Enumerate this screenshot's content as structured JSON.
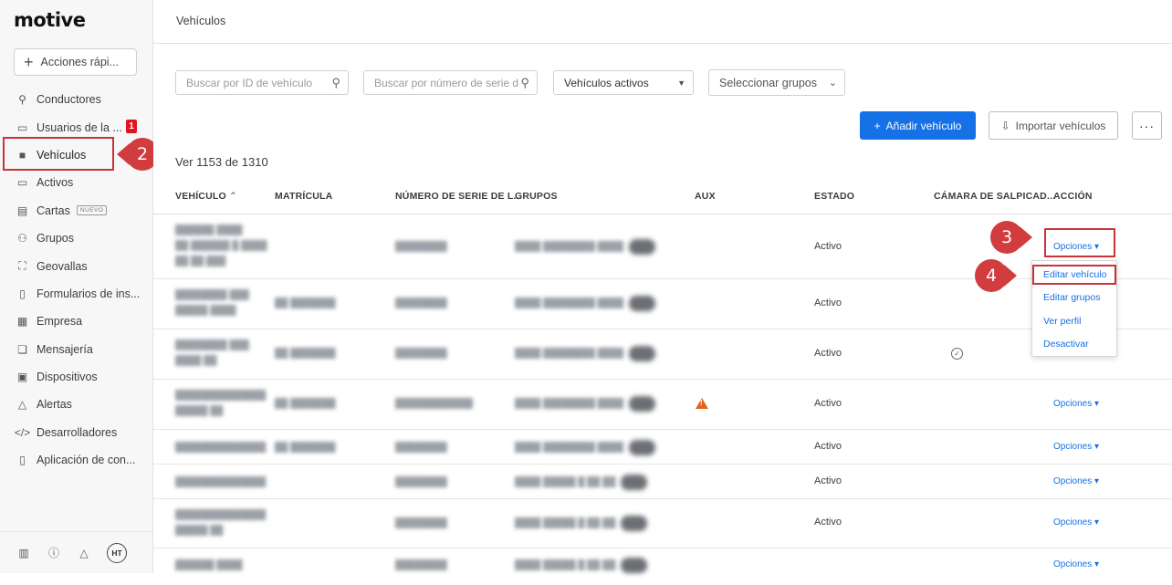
{
  "brand": {
    "name": "motive"
  },
  "sidebar": {
    "quick_actions": "Acciones rápi...",
    "items": [
      {
        "label": "Conductores",
        "icon": "person-icon"
      },
      {
        "label": "Usuarios de la ...",
        "icon": "monitor-icon",
        "badge": "1"
      },
      {
        "label": "Vehículos",
        "icon": "truck-icon"
      },
      {
        "label": "Activos",
        "icon": "trailer-icon"
      },
      {
        "label": "Cartas",
        "icon": "card-icon",
        "tag": "NUEVO"
      },
      {
        "label": "Grupos",
        "icon": "group-icon"
      },
      {
        "label": "Geovallas",
        "icon": "geofence-icon"
      },
      {
        "label": "Formularios de ins...",
        "icon": "document-icon"
      },
      {
        "label": "Empresa",
        "icon": "building-icon"
      },
      {
        "label": "Mensajería",
        "icon": "chat-icon"
      },
      {
        "label": "Dispositivos",
        "icon": "devices-icon"
      },
      {
        "label": "Alertas",
        "icon": "bell-icon"
      },
      {
        "label": "Desarrolladores",
        "icon": "code-icon"
      },
      {
        "label": "Aplicación de con...",
        "icon": "phone-icon"
      }
    ],
    "avatar": "HT"
  },
  "header": {
    "title": "Vehículos"
  },
  "filters": {
    "search_id_placeholder": "Buscar por ID de vehículo",
    "search_serial_placeholder": "Buscar por número de serie d",
    "status_select": "Vehículos activos",
    "groups_select": "Seleccionar grupos"
  },
  "actions": {
    "add": "Añadir vehículo",
    "import": "Importar vehículos",
    "more": "···"
  },
  "count_text": "Ver 1153 de 1310",
  "table": {
    "headers": [
      "VEHÍCULO",
      "MATRÍCULA",
      "NÚMERO DE SERIE DE L...",
      "GRUPOS",
      "AUX",
      "ESTADO",
      "CÁMARA DE SALPICAD...",
      "ACCIÓN"
    ],
    "rows": [
      {
        "status": "Activo",
        "action": "Opciones ▾"
      },
      {
        "status": "Activo",
        "action": ""
      },
      {
        "status": "Activo",
        "action": ""
      },
      {
        "status": "Activo",
        "action": "Opciones ▾"
      },
      {
        "status": "Activo",
        "action": "Opciones ▾"
      },
      {
        "status": "Activo",
        "action": "Opciones ▾"
      },
      {
        "status": "Activo",
        "action": "Opciones ▾"
      },
      {
        "status": "",
        "action": "Opciones ▾"
      }
    ]
  },
  "dropdown": {
    "items": [
      "Editar vehículo",
      "Editar grupos",
      "Ver perfil",
      "Desactivar"
    ]
  },
  "markers": [
    "2",
    "3",
    "4"
  ],
  "colors": {
    "primary": "#1670e6",
    "highlight": "#c8343a",
    "badge": "#e0161e"
  }
}
